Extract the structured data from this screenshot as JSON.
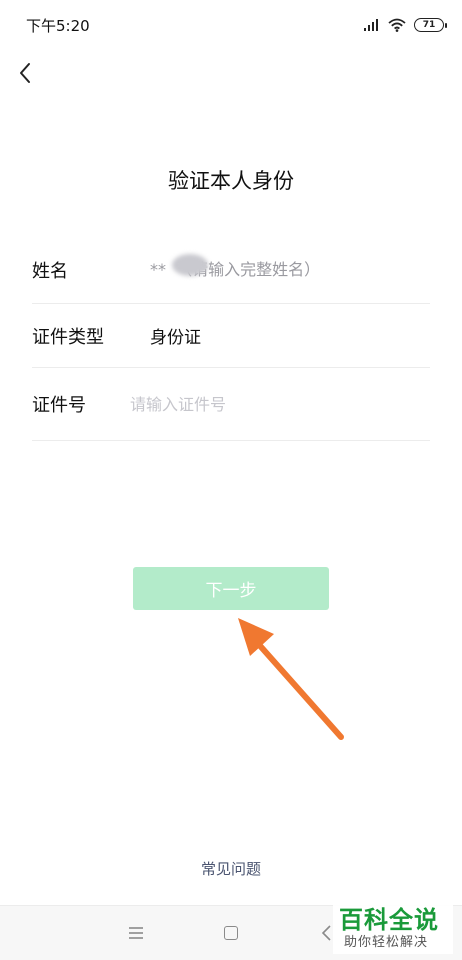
{
  "status_bar": {
    "time": "下午5:20",
    "battery": "71"
  },
  "header": {
    "title": "验证本人身份"
  },
  "form": {
    "name": {
      "label": "姓名",
      "placeholder": "**  （请输入完整姓名）"
    },
    "id_type": {
      "label": "证件类型",
      "value": "身份证"
    },
    "id_number": {
      "label": "证件号",
      "placeholder": "请输入证件号"
    }
  },
  "actions": {
    "next_label": "下一步",
    "next_color": "#b3ebca"
  },
  "footer": {
    "faq_label": "常见问题"
  },
  "watermark": {
    "brand": "百科全说",
    "tagline": "助你轻松解决"
  },
  "colors": {
    "annotation_arrow": "#f07830",
    "watermark_green": "#1a9a3a"
  }
}
